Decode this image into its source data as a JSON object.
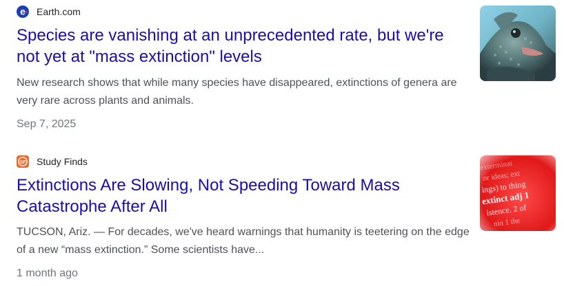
{
  "results": [
    {
      "source": "Earth.com",
      "source_icon": "earth-com-logo-icon",
      "title": "Species are vanishing at an unprecedented rate, but we're not yet at \"mass extinction\" levels",
      "snippet": "New research shows that while many species have disappeared, extinctions of genera are very rare across plants and animals.",
      "date": "Sep 7, 2025",
      "thumbnail": "lizard-thumbnail"
    },
    {
      "source": "Study Finds",
      "source_icon": "study-finds-logo-icon",
      "title": "Extinctions Are Slowing, Not Speeding Toward Mass Catastrophe After All",
      "snippet": "TUCSON, Ariz. — For decades, we've heard warnings that humanity is teetering on the edge of a new “mass extinction.” Some scientists have...",
      "date": "1 month ago",
      "thumbnail": "dictionary-extinct-thumbnail",
      "thumbnail_text": [
        "exterminat",
        "or ideas; ext",
        "ings) to thing",
        "extinct adj 1",
        "istence. 2 of",
        "nin 1 the"
      ]
    }
  ],
  "colors": {
    "title": "#1a0dab",
    "snippet": "#4d5156",
    "meta": "#70757a",
    "source": "#202124"
  }
}
